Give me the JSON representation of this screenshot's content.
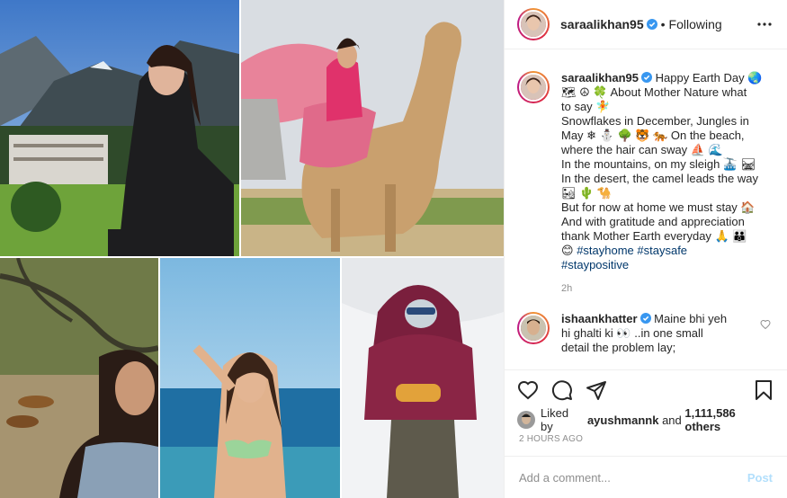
{
  "post": {
    "username": "saraalikhan95",
    "separator": "•",
    "follow_status": "Following",
    "caption": {
      "username": "saraalikhan95",
      "lines": [
        "Happy Earth Day 🌏",
        "🗺 ☮ 🍀 About Mother Nature what",
        "to say 🧚",
        "Snowflakes in December, Jungles in",
        "May ❄ ⛄ 🌳 🐯 🐅 On the beach,",
        "where the hair can sway ⛵ 🌊",
        "In the mountains, on my sleigh 🚠 🛤",
        "In the desert, the camel leads the way",
        "🏜 🌵 🐪",
        "But for now at home we must stay 🏠",
        "And with gratitude and appreciation",
        "thank Mother Earth everyday 🙏 👪",
        "😊"
      ],
      "hashtags_line1": "#stayhome #staysafe",
      "hashtags_line2": "#staypositive",
      "time": "2h"
    },
    "reply": {
      "username": "ishaankhatter",
      "line1": "Maine bhi yeh",
      "line2": "hi ghalti ki 👀 ..in one small",
      "line3": "detail the problem lay;"
    },
    "likes": {
      "prefix": "Liked by",
      "user": "ayushmannk",
      "and": "and",
      "count": "1,111,586 others"
    },
    "date": "2 HOURS AGO",
    "comment_box": {
      "placeholder": "Add a comment...",
      "post_label": "Post"
    }
  },
  "icons": {
    "verified": "verified-badge-icon",
    "more": "more-options-icon",
    "like": "heart-icon",
    "comment": "comment-icon",
    "share": "share-icon",
    "save": "bookmark-icon"
  },
  "colors": {
    "verified": "#3897f0",
    "link": "#00376b",
    "muted": "#8e8e8e",
    "post_button": "#b2dffc"
  }
}
